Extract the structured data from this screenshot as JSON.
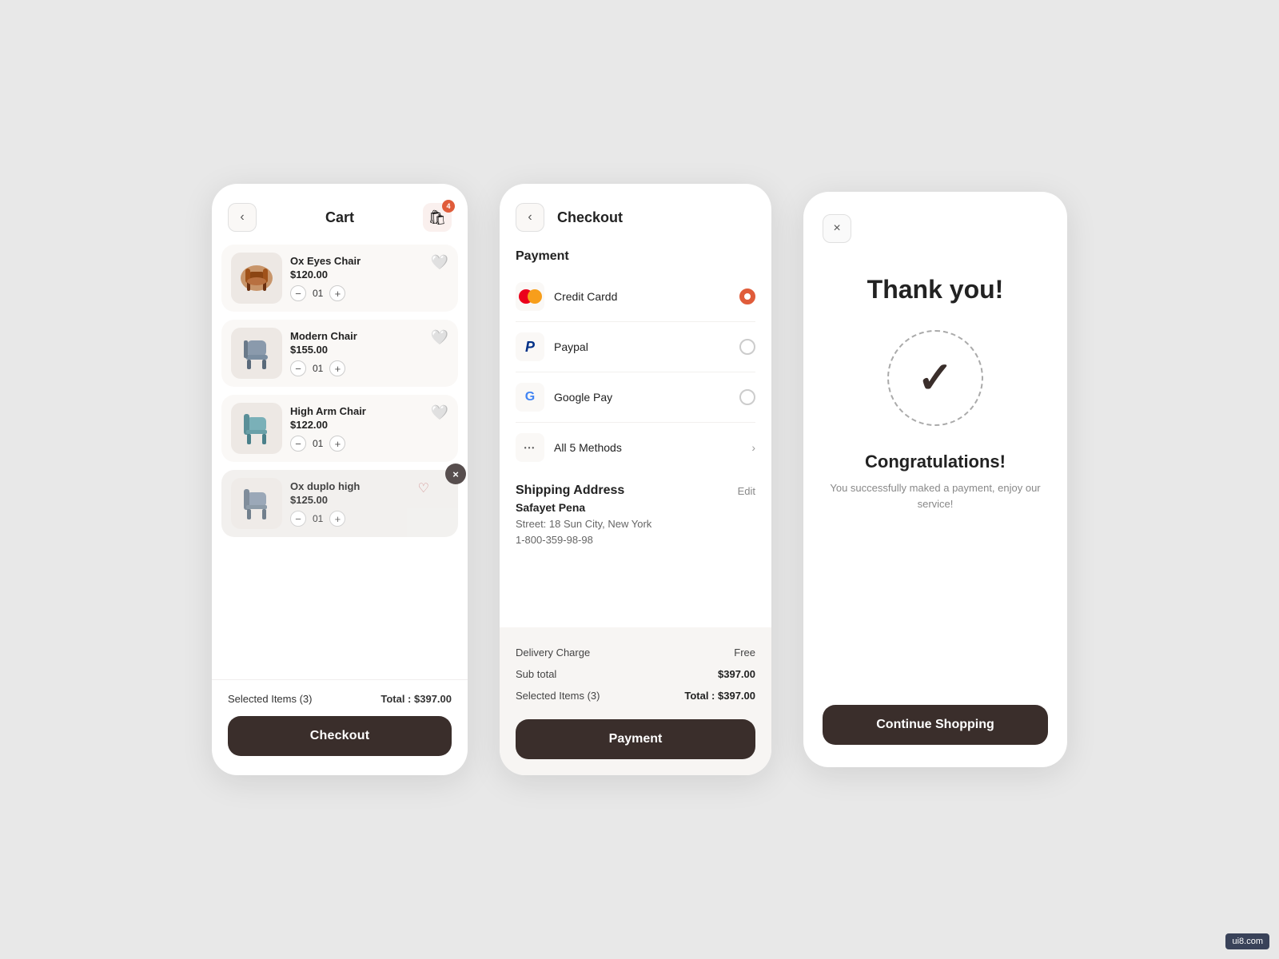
{
  "app": {
    "background": "#e8e8e8",
    "watermark": "ui8.com"
  },
  "cart": {
    "title": "Cart",
    "back_label": "‹",
    "badge_count": "4",
    "items": [
      {
        "id": 1,
        "name": "Ox Eyes Chair",
        "price": "$120.00",
        "qty": "01",
        "color": "brown",
        "has_fav": true,
        "fav_active": false,
        "deleting": false
      },
      {
        "id": 2,
        "name": "Modern Chair",
        "price": "$155.00",
        "qty": "01",
        "color": "gray",
        "has_fav": true,
        "fav_active": false,
        "deleting": false
      },
      {
        "id": 3,
        "name": "High Arm Chair",
        "price": "$122.00",
        "qty": "01",
        "color": "teal",
        "has_fav": true,
        "fav_active": false,
        "deleting": false
      },
      {
        "id": 4,
        "name": "Ox duplo high",
        "price": "$125.00",
        "qty": "01",
        "color": "darkgray",
        "has_fav": true,
        "fav_active": true,
        "deleting": true
      }
    ],
    "selected_label": "Selected Items (3)",
    "total_label": "Total : $397.00",
    "checkout_btn": "Checkout"
  },
  "checkout": {
    "title": "Checkout",
    "back_label": "‹",
    "payment_section": "Payment",
    "payment_methods": [
      {
        "id": "credit",
        "name": "Credit Cardd",
        "icon": "mastercard",
        "selected": true
      },
      {
        "id": "paypal",
        "name": "Paypal",
        "icon": "paypal",
        "selected": false
      },
      {
        "id": "gpay",
        "name": "Google Pay",
        "icon": "google",
        "selected": false
      },
      {
        "id": "more",
        "name": "All 5 Methods",
        "icon": "dots",
        "selected": false,
        "is_more": true
      }
    ],
    "shipping_section": "Shipping Address",
    "edit_label": "Edit",
    "shipping_name": "Safayet Pena",
    "shipping_street": "Street: 18 Sun City, New York",
    "shipping_phone": "1-800-359-98-98",
    "delivery_charge_label": "Delivery Charge",
    "delivery_charge_value": "Free",
    "subtotal_label": "Sub total",
    "subtotal_value": "$397.00",
    "selected_items_label": "Selected Items (3)",
    "total_value": "Total : $397.00",
    "payment_btn": "Payment"
  },
  "thankyou": {
    "title": "Thank you!",
    "close_label": "×",
    "congrats_title": "Congratulations!",
    "congrats_sub": "You successfully maked a payment, enjoy our service!",
    "continue_btn": "Continue Shopping"
  }
}
